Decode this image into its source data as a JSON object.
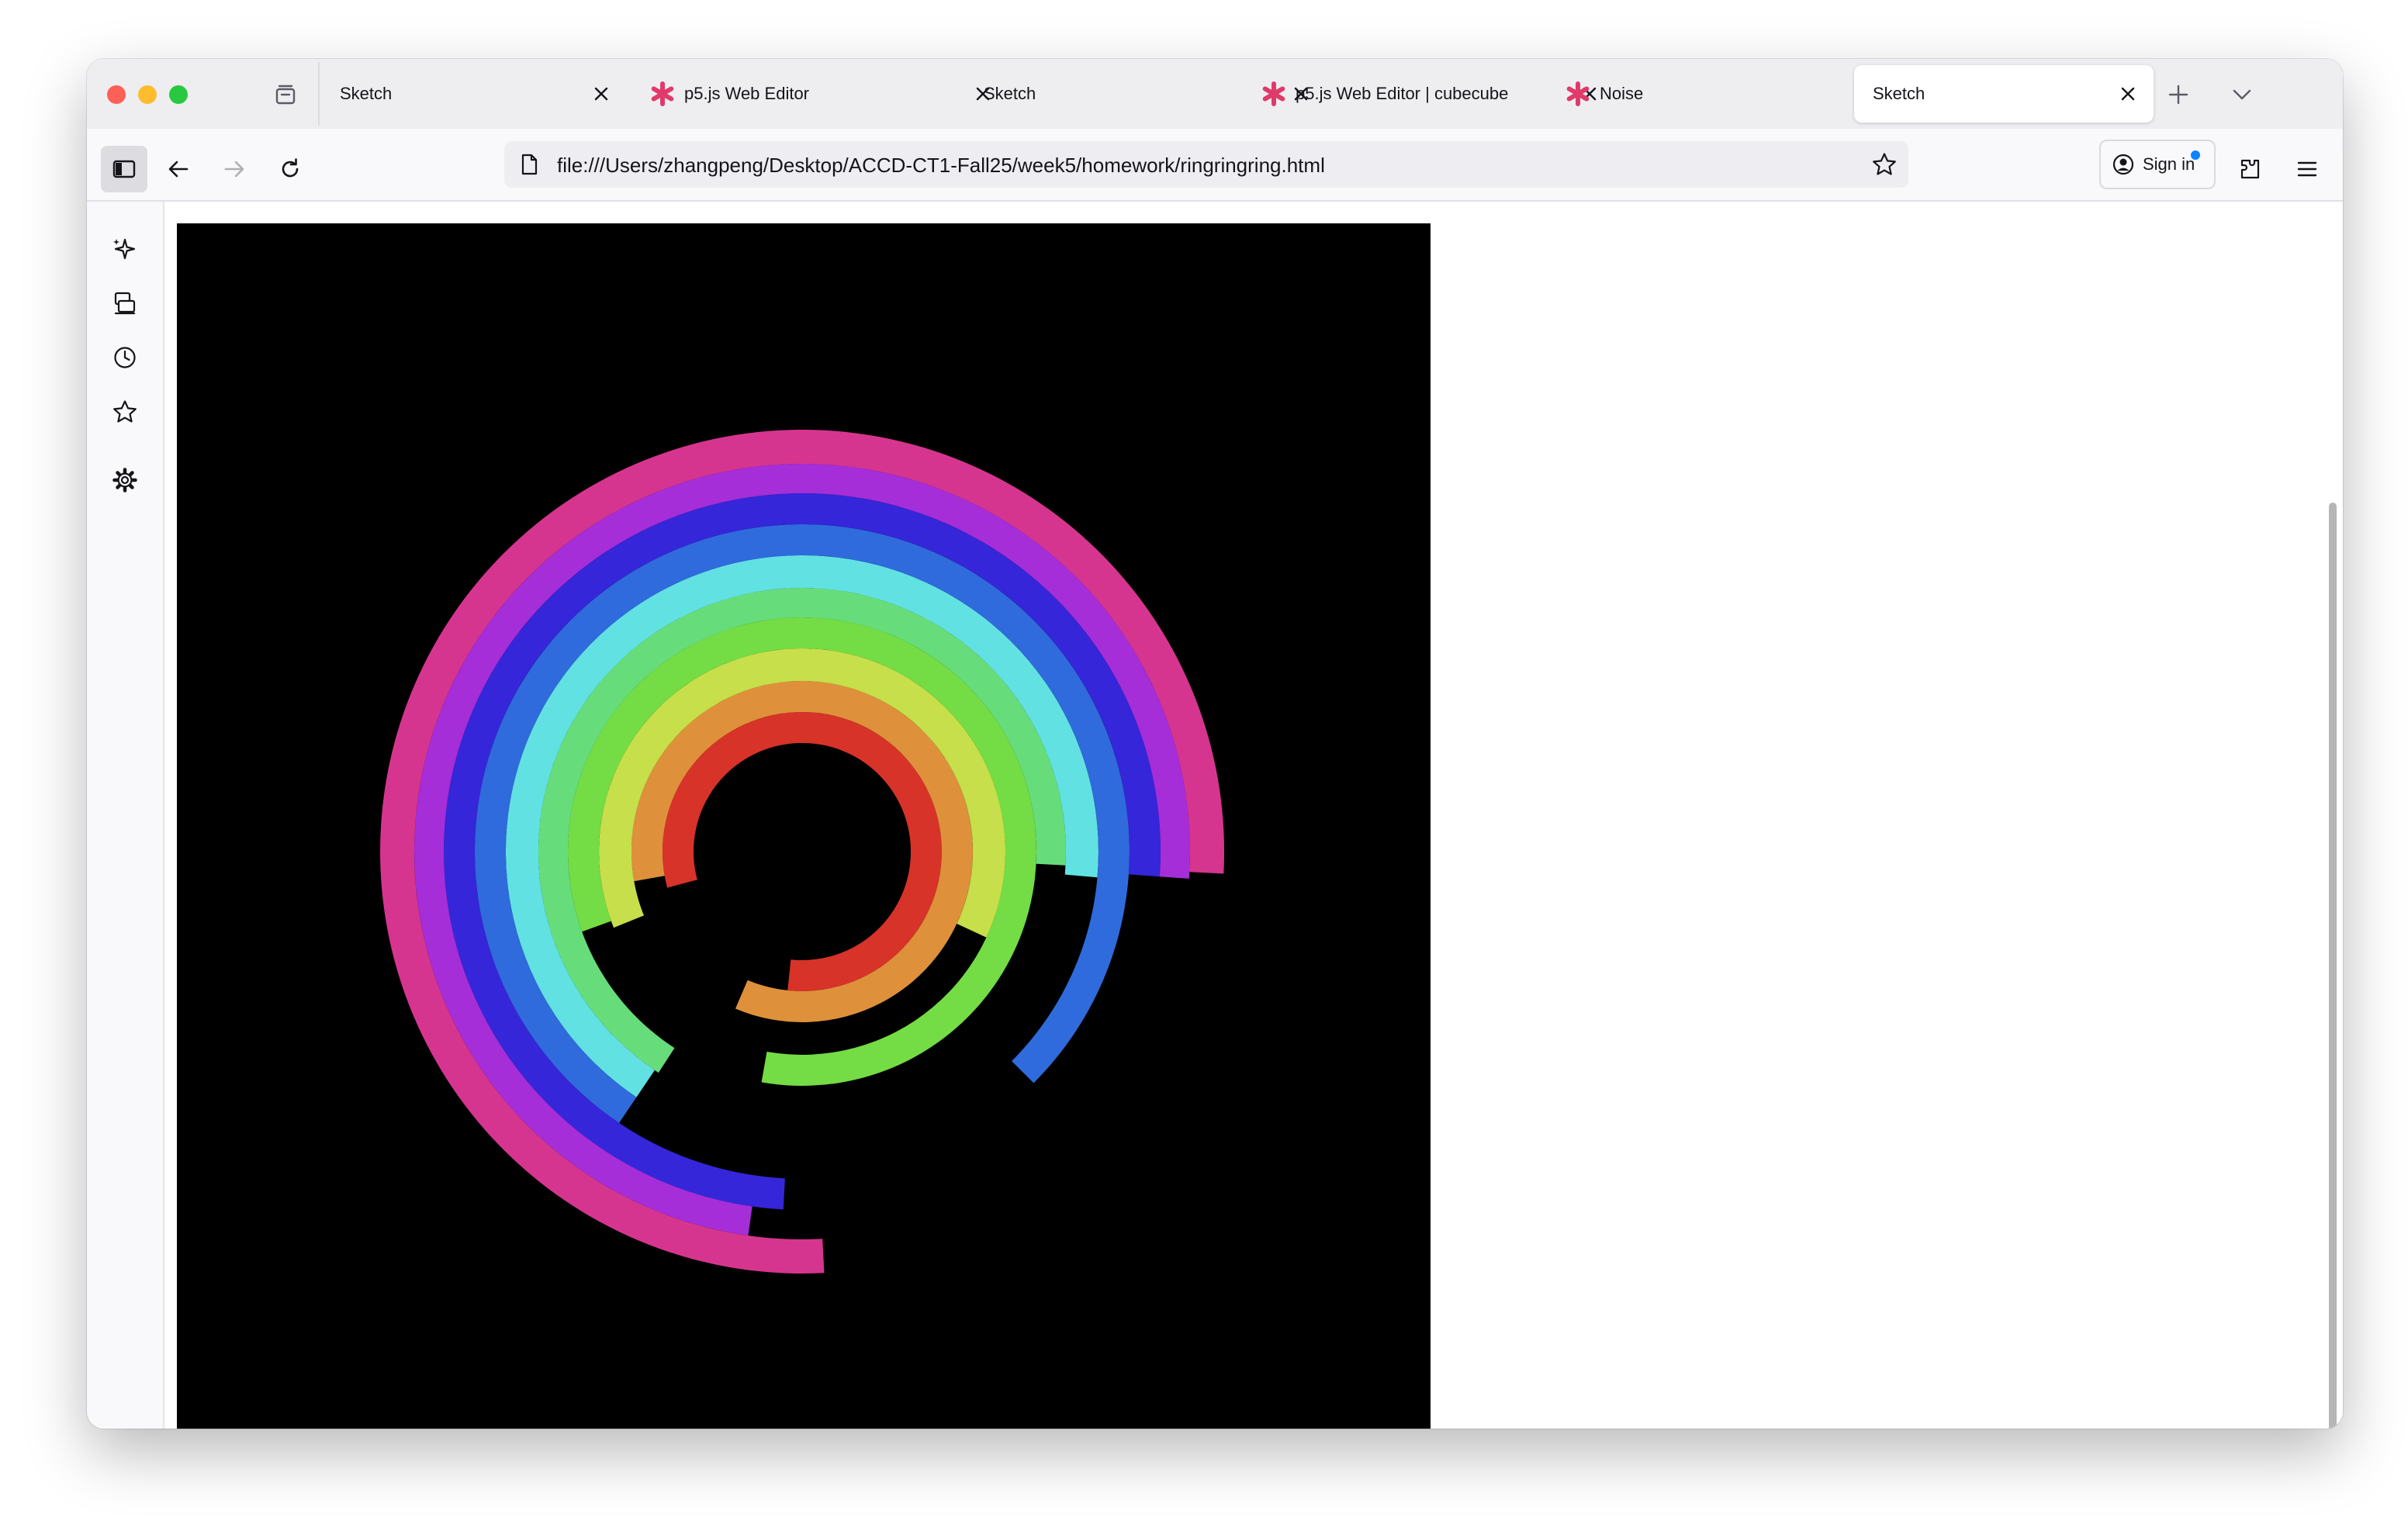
{
  "browser": {
    "tabs": [
      {
        "title": "Sketch",
        "favicon": "none",
        "active": false
      },
      {
        "title": "p5.js Web Editor",
        "favicon": "p5js-asterisk-icon",
        "active": false
      },
      {
        "title": "Sketch",
        "favicon": "none",
        "active": false
      },
      {
        "title": "p5.js Web Editor | cubecube",
        "favicon": "p5js-asterisk-icon",
        "active": false
      },
      {
        "title": "Noise",
        "favicon": "p5js-asterisk-icon",
        "active": false
      },
      {
        "title": "Sketch",
        "favicon": "none",
        "active": true
      }
    ],
    "url": "file:///Users/zhangpeng/Desktop/ACCD-CT1-Fall25/week5/homework/ringringring.html",
    "signin_label": "Sign in",
    "accent_color": "#e03a6b",
    "notification_dot_color": "#0a84ff"
  },
  "sidebar": {
    "items": [
      "ai-sparkle-icon",
      "synced-tabs-icon",
      "history-icon",
      "bookmarks-icon",
      "settings-icon"
    ]
  },
  "sketch": {
    "background": "#000000",
    "ring_colors": [
      "#d73329",
      "#de913a",
      "#c6df4a",
      "#74dc44",
      "#66dd7a",
      "#62e1e3",
      "#2f6bdc",
      "#3526d9",
      "#a52ed8",
      "#d6358f"
    ]
  }
}
